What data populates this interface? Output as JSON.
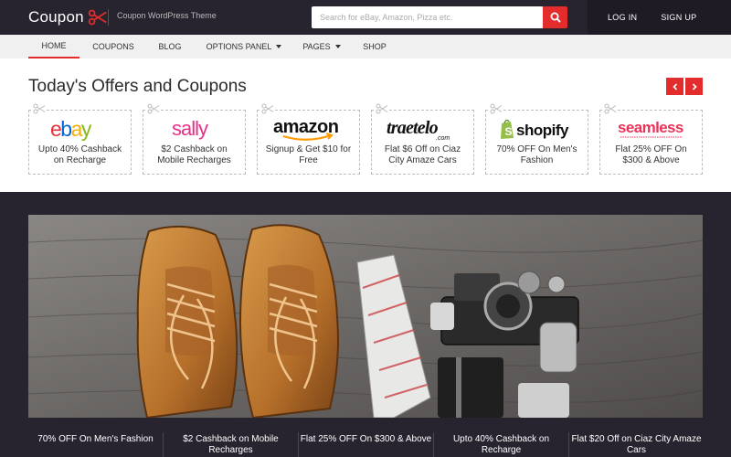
{
  "header": {
    "logo_text": "Coupon",
    "tagline": "Coupon WordPress Theme",
    "search_placeholder": "Search for eBay, Amazon, Pizza etc.",
    "login": "LOG IN",
    "signup": "SIGN UP"
  },
  "nav": {
    "items": [
      "HOME",
      "COUPONS",
      "BLOG",
      "OPTIONS PANEL",
      "PAGES",
      "SHOP"
    ],
    "active": "HOME"
  },
  "offers": {
    "title": "Today's Offers and Coupons",
    "cards": [
      {
        "brand": "ebay",
        "offer": "Upto 40% Cashback on Recharge"
      },
      {
        "brand": "sally",
        "offer": "$2 Cashback on Mobile Recharges"
      },
      {
        "brand": "amazon",
        "offer": "Signup & Get $10 for Free"
      },
      {
        "brand": "traetelo.com",
        "offer": "Flat $6 Off on Ciaz City Amaze Cars"
      },
      {
        "brand": "shopify",
        "offer": "70% OFF On Men's Fashion"
      },
      {
        "brand": "seamless",
        "offer": "Flat 25% OFF On $300 & Above"
      }
    ]
  },
  "strip": {
    "items": [
      "70% OFF On Men's Fashion",
      "$2 Cashback on Mobile Recharges",
      "Flat 25% OFF On $300 & Above",
      "Upto 40% Cashback on Recharge",
      "Flat $20 Off on Ciaz City Amaze Cars"
    ]
  },
  "colors": {
    "accent": "#e32c2c",
    "dark": "#27232f",
    "nav_bg": "#f0f0f0"
  },
  "icons": {
    "logo": "scissors-icon",
    "search": "search-icon",
    "prev": "chevron-left-icon",
    "next": "chevron-right-icon",
    "card_snip": "scissors-icon"
  }
}
